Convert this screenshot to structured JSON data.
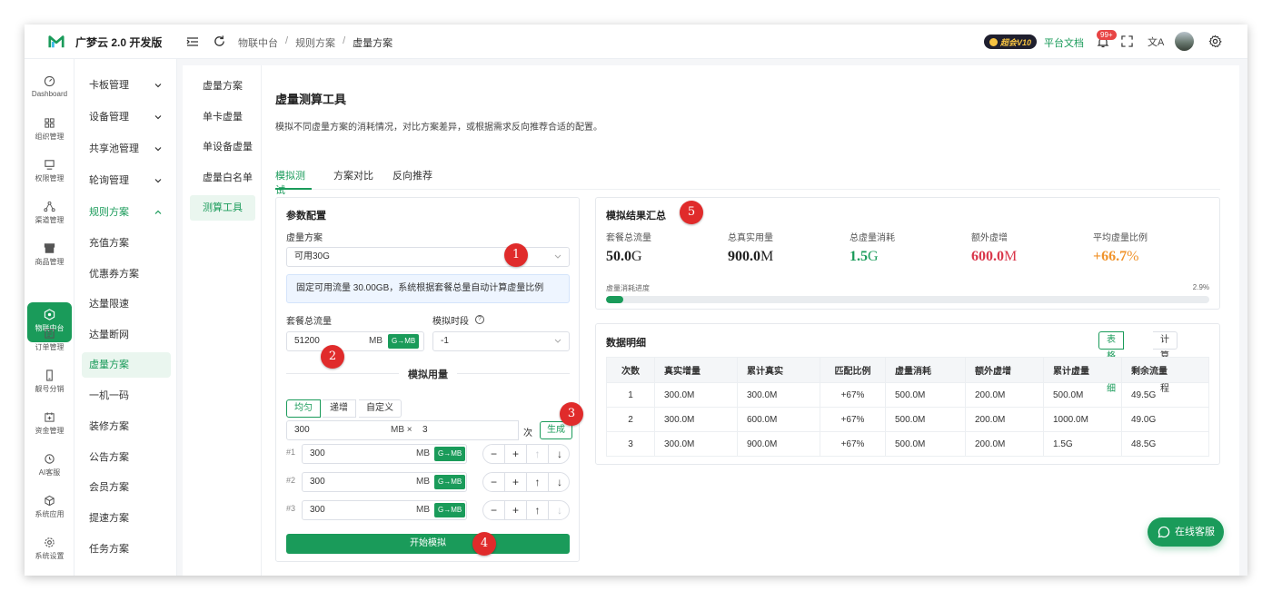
{
  "app": {
    "title": "广梦云 2.0 开发版"
  },
  "breadcrumb": [
    "物联中台",
    "规则方案",
    "虚量方案"
  ],
  "header": {
    "vip": "超会V10",
    "docs": "平台文档",
    "notif_badge": "99+",
    "lang": "文A"
  },
  "rail": [
    {
      "label": "Dashboard",
      "icon": "gauge-icon"
    },
    {
      "label": "组织管理",
      "icon": "grid-icon"
    },
    {
      "label": "权限管理",
      "icon": "monitor-icon"
    },
    {
      "label": "渠道管理",
      "icon": "share-icon"
    },
    {
      "label": "商品管理",
      "icon": "store-icon"
    },
    {
      "label": "物联中台",
      "icon": "iot-icon"
    },
    {
      "label": "订单管理",
      "icon": "list-icon"
    },
    {
      "label": "靓号分销",
      "icon": "phone-icon"
    },
    {
      "label": "资金管理",
      "icon": "wallet-icon"
    },
    {
      "label": "AI客服",
      "icon": "ai-icon"
    },
    {
      "label": "系统应用",
      "icon": "cube-icon"
    },
    {
      "label": "系统设置",
      "icon": "gear-icon"
    }
  ],
  "submenu": [
    {
      "label": "卡板管理"
    },
    {
      "label": "设备管理"
    },
    {
      "label": "共享池管理"
    },
    {
      "label": "轮询管理"
    },
    {
      "label": "规则方案"
    },
    {
      "label": "充值方案"
    },
    {
      "label": "优惠券方案"
    },
    {
      "label": "达量限速"
    },
    {
      "label": "达量断网"
    },
    {
      "label": "虚量方案"
    },
    {
      "label": "一机一码"
    },
    {
      "label": "装修方案"
    },
    {
      "label": "公告方案"
    },
    {
      "label": "会员方案"
    },
    {
      "label": "提速方案"
    },
    {
      "label": "任务方案"
    }
  ],
  "inner_nav": [
    "虚量方案",
    "单卡虚量",
    "单设备虚量",
    "虚量白名单",
    "测算工具"
  ],
  "page": {
    "title": "虚量测算工具",
    "desc": "模拟不同虚量方案的消耗情况，对比方案差异，或根据需求反向推荐合适的配置。",
    "tabs": [
      "模拟测试",
      "方案对比",
      "反向推荐"
    ]
  },
  "params": {
    "title": "参数配置",
    "plan_label": "虚量方案",
    "plan_value": "可用30G",
    "info": "固定可用流量 30.00GB，系统根据套餐总量自动计算虚量比例",
    "total_label": "套餐总流量",
    "total_value": "51200",
    "unit_mb": "MB",
    "gmb": "G→MB",
    "period_label": "模拟时段",
    "period_value": "-1",
    "help": "?",
    "sim_title": "模拟用量",
    "modes": [
      "均匀",
      "递增",
      "自定义"
    ],
    "gen_value": "300",
    "gen_unit": "MB ×",
    "gen_count": "3",
    "gen_count_unit": "次",
    "gen_button": "生成",
    "rows": [
      {
        "no": "#1",
        "value": "300"
      },
      {
        "no": "#2",
        "value": "300"
      },
      {
        "no": "#3",
        "value": "300"
      }
    ],
    "ctrl": {
      "minus": "−",
      "plus": "+",
      "up": "↑",
      "down": "↓"
    },
    "start": "开始模拟"
  },
  "summary": {
    "title": "模拟结果汇总",
    "stats": [
      {
        "label": "套餐总流量",
        "num": "50.0",
        "unit": "G",
        "color": "#222222"
      },
      {
        "label": "总真实用量",
        "num": "900.0",
        "unit": "M",
        "color": "#222222"
      },
      {
        "label": "总虚量消耗",
        "num": "1.5",
        "unit": "G",
        "color": "#1a9b5a"
      },
      {
        "label": "额外虚增",
        "num": "600.0",
        "unit": "M",
        "color": "#d9364a"
      },
      {
        "label": "平均虚量比例",
        "num": "+66.7",
        "unit": "%",
        "color": "#f0932b"
      }
    ],
    "progress_label": "虚量消耗进度",
    "progress_text": "2.9%",
    "progress_fraction": 0.029
  },
  "detail": {
    "title": "数据明细",
    "views": [
      "表格明细",
      "计算过程"
    ],
    "columns": [
      "次数",
      "真实增量",
      "累计真实",
      "匹配比例",
      "虚量消耗",
      "额外虚增",
      "累计虚量",
      "剩余流量"
    ],
    "rows": [
      [
        "1",
        "300.0M",
        "300.0M",
        "+67%",
        "500.0M",
        "200.0M",
        "500.0M",
        "49.5G"
      ],
      [
        "2",
        "300.0M",
        "600.0M",
        "+67%",
        "500.0M",
        "200.0M",
        "1000.0M",
        "49.0G"
      ],
      [
        "3",
        "300.0M",
        "900.0M",
        "+67%",
        "500.0M",
        "200.0M",
        "1.5G",
        "48.5G"
      ]
    ]
  },
  "chat": {
    "label": "在线客服"
  },
  "markers": [
    "1",
    "2",
    "3",
    "4",
    "5"
  ]
}
